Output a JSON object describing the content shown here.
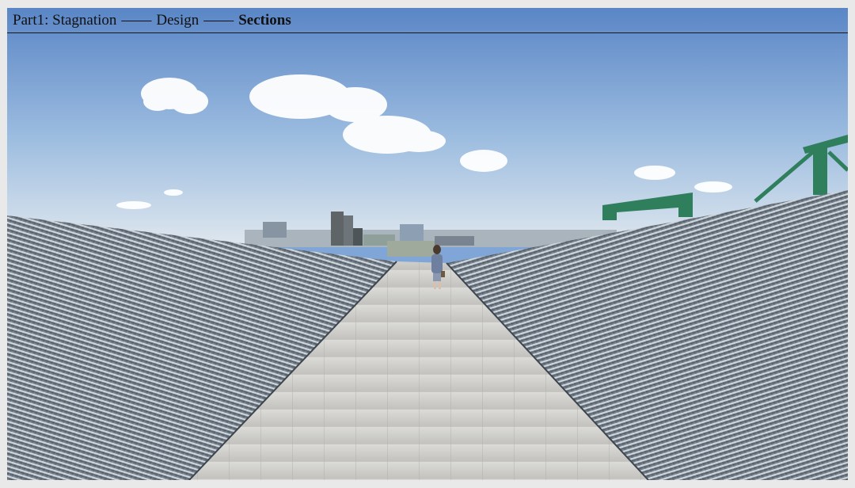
{
  "breadcrumb": {
    "part": "Part1: Stagnation",
    "separator_1": "——",
    "section": "Design",
    "separator_2": "——",
    "current": "Sections"
  },
  "scene": {
    "sky_top_color": "#5d88c8",
    "sky_bottom_color": "#d7e3ef",
    "paving_color": "#c9c8c4",
    "roof_ridge_color": "#8d96a0",
    "structure_color": "#2f7f5d"
  }
}
